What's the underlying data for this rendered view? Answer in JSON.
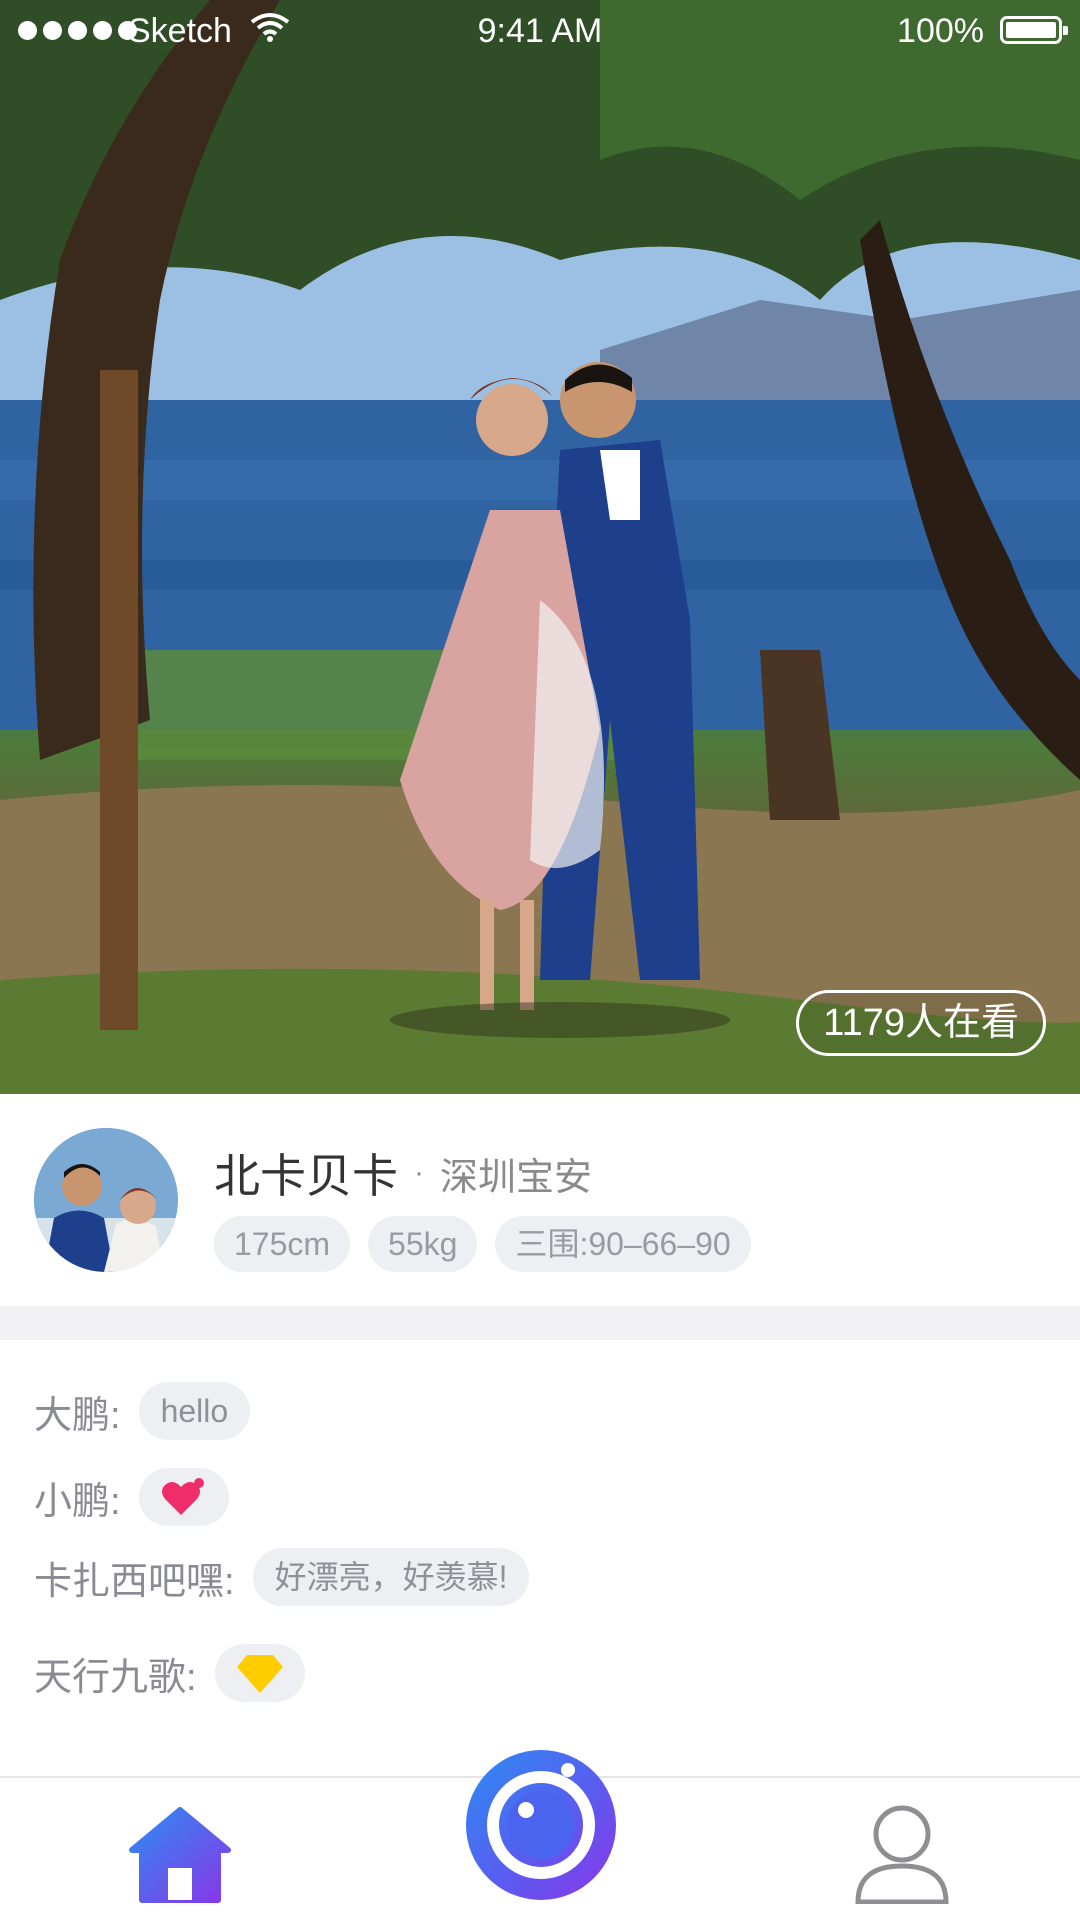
{
  "status_bar": {
    "carrier": "Sketch",
    "time": "9:41 AM",
    "battery": "100%"
  },
  "hero": {
    "viewers": "1179人在看"
  },
  "profile": {
    "name": "北卡贝卡",
    "separator": "·",
    "location": "深圳宝安",
    "tags": [
      "175cm",
      "55kg",
      "三围:90–66–90"
    ]
  },
  "comments": [
    {
      "user": "大鹏:",
      "text": "hello",
      "type": "text"
    },
    {
      "user": "小鹏:",
      "type": "heart-icon",
      "color": "#ef2d6b"
    },
    {
      "user": "卡扎西吧嘿:",
      "text": "好漂亮，好羡慕!",
      "type": "text"
    },
    {
      "user": "天行九歌:",
      "type": "diamond-icon",
      "color": "#ffcc00"
    }
  ],
  "tabbar": {
    "home_icon": "home-icon",
    "camera_icon": "camera-icon",
    "profile_icon": "user-icon",
    "accent_start": "#2c8cf2",
    "accent_end": "#8a36e8"
  }
}
